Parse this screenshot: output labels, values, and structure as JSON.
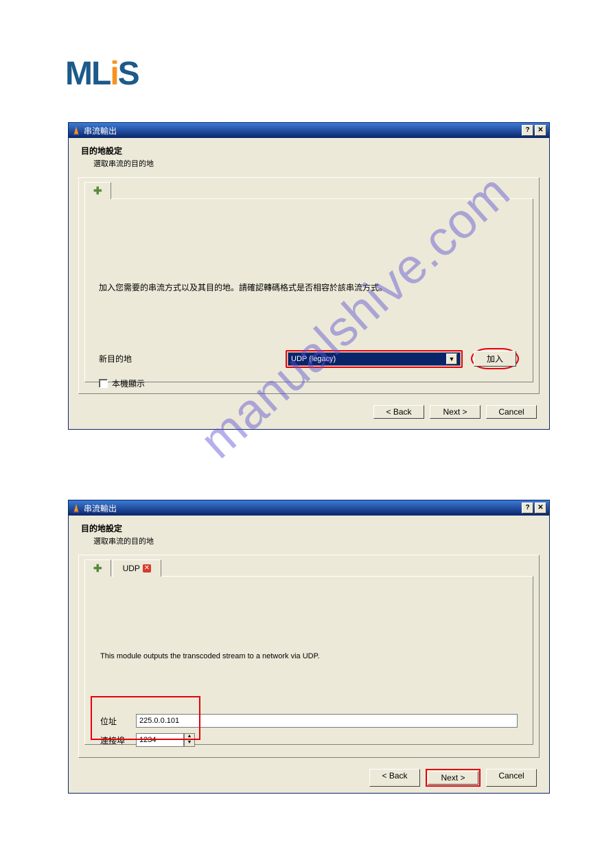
{
  "logo": {
    "text": "MLiS"
  },
  "watermark": "manualshive.com",
  "dialog1": {
    "title": "串流輸出",
    "header": {
      "title": "目的地設定",
      "sub": "選取串流的目的地"
    },
    "tabs": {
      "plus": "✚"
    },
    "body_text": "加入您需要的串流方式以及其目的地。請確認轉碼格式是否相容於該串流方式。",
    "dest_label": "新目的地",
    "combo_value": "UDP (legacy)",
    "add_btn": "加入",
    "checkbox_label": "本機顯示",
    "buttons": {
      "back": "< Back",
      "next": "Next >",
      "cancel": "Cancel"
    }
  },
  "dialog2": {
    "title": "串流輸出",
    "header": {
      "title": "目的地設定",
      "sub": "選取串流的目的地"
    },
    "tabs": {
      "plus": "✚",
      "udp": "UDP"
    },
    "desc": "This module outputs the transcoded stream to a network via UDP.",
    "addr_label": "位址",
    "addr_value": "225.0.0.101",
    "port_label": "連接埠",
    "port_value": "1234",
    "buttons": {
      "back": "< Back",
      "next": "Next >",
      "cancel": "Cancel"
    }
  }
}
